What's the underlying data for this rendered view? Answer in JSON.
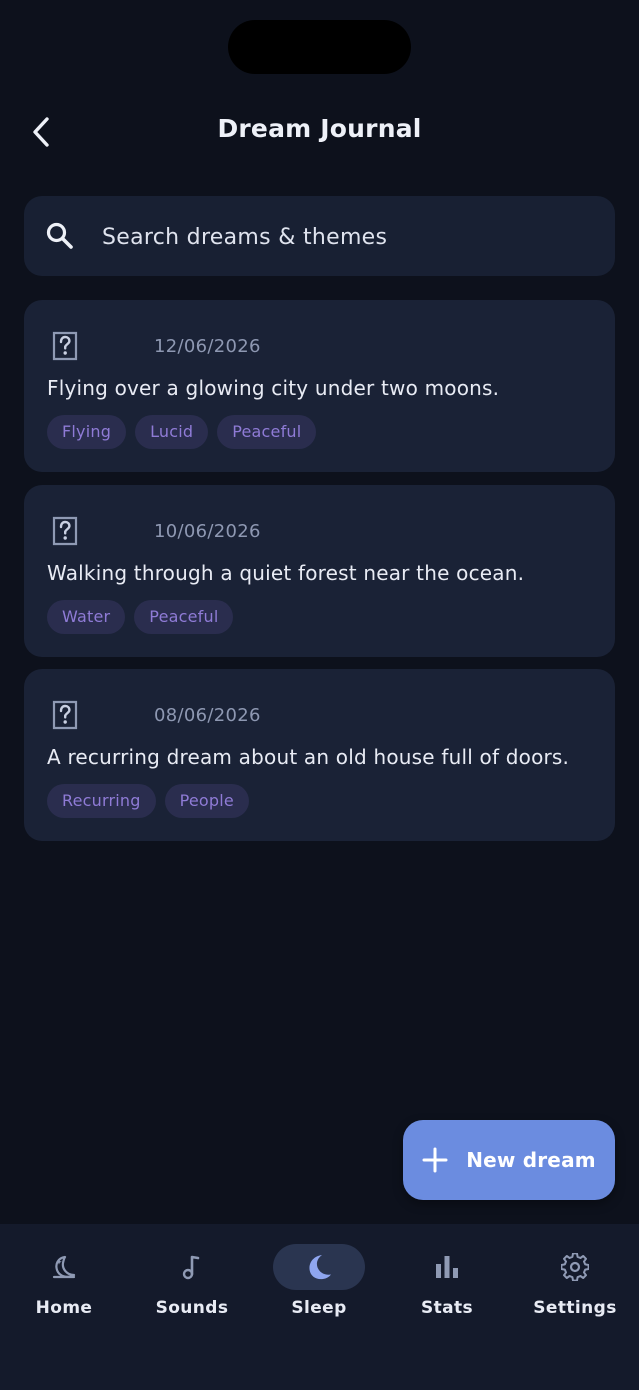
{
  "header": {
    "title": "Dream Journal",
    "back_icon": "chevron-left-icon"
  },
  "search": {
    "placeholder": "Search dreams & themes",
    "value": "",
    "icon": "search-icon"
  },
  "dreams": [
    {
      "icon": "question-icon",
      "date": "12/06/2026",
      "text": "Flying over a glowing city under two moons.",
      "tags": [
        "Flying",
        "Lucid",
        "Peaceful"
      ]
    },
    {
      "icon": "question-icon",
      "date": "10/06/2026",
      "text": "Walking through a quiet forest near the ocean.",
      "tags": [
        "Water",
        "Peaceful"
      ]
    },
    {
      "icon": "question-icon",
      "date": "08/06/2026",
      "text": "A recurring dream about an old house full of doors.",
      "tags": [
        "Recurring",
        "People"
      ]
    }
  ],
  "fab": {
    "label": "New dream",
    "icon": "plus-icon"
  },
  "nav": {
    "active": "Sleep",
    "items": [
      {
        "label": "Home",
        "icon": "moon-sparkle-icon"
      },
      {
        "label": "Sounds",
        "icon": "music-note-icon"
      },
      {
        "label": "Sleep",
        "icon": "crescent-moon-icon"
      },
      {
        "label": "Stats",
        "icon": "bar-chart-icon"
      },
      {
        "label": "Settings",
        "icon": "gear-icon"
      }
    ]
  },
  "colors": {
    "background": "#0d111c",
    "card": "#1a2236",
    "accent": "#6b8ce0",
    "tag_bg": "#2a2d4e",
    "tag_text": "#8f7bd6",
    "nav_bg": "#141a2b"
  }
}
